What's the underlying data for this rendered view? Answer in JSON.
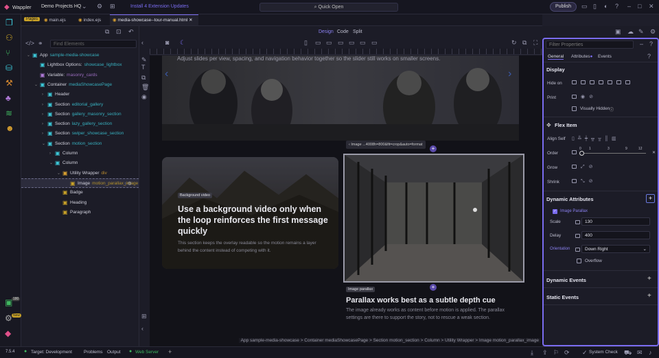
{
  "app": {
    "name": "Wappler",
    "project": "Demo Projects HQ",
    "update": "Install 4 Extension Updates",
    "quick_open": "Quick Open",
    "publish": "Publish"
  },
  "tabs": {
    "pages": "Pages",
    "items": [
      "main.ejs",
      "index.ejs",
      "media-showcase--tour-manual.html"
    ]
  },
  "tree": {
    "find_placeholder": "Find Elements",
    "items": [
      {
        "label": "App",
        "sub": "sample-media-showcase",
        "c": "cy",
        "d": 0,
        "arrow": "v"
      },
      {
        "label": "Lightbox Options:",
        "sub": "showcase_lightbox",
        "c": "cy",
        "d": 1,
        "arrow": ""
      },
      {
        "label": "Variable:",
        "sub": "masonry_cards",
        "c": "vi",
        "d": 1,
        "arrow": ""
      },
      {
        "label": "Container",
        "sub": "mediaShowcasePage",
        "c": "cy",
        "d": 1,
        "arrow": "v"
      },
      {
        "label": "Header",
        "sub": "",
        "c": "cy",
        "d": 2,
        "arrow": ">"
      },
      {
        "label": "Section",
        "sub": "editorial_gallery",
        "c": "cy",
        "d": 2,
        "arrow": ">"
      },
      {
        "label": "Section",
        "sub": "gallery_masonry_section",
        "c": "cy",
        "d": 2,
        "arrow": ">"
      },
      {
        "label": "Section",
        "sub": "lazy_gallery_section",
        "c": "cy",
        "d": 2,
        "arrow": ">"
      },
      {
        "label": "Section",
        "sub": "swiper_showcase_section",
        "c": "cy",
        "d": 2,
        "arrow": ">"
      },
      {
        "label": "Section",
        "sub": "motion_section",
        "c": "cy",
        "d": 2,
        "arrow": "v"
      },
      {
        "label": "Column",
        "sub": "",
        "c": "cy",
        "d": 3,
        "arrow": ">"
      },
      {
        "label": "Column",
        "sub": "",
        "c": "cy",
        "d": 3,
        "arrow": "v"
      },
      {
        "label": "Utility Wrapper",
        "sub": "div",
        "c": "ye",
        "d": 4,
        "arrow": "v"
      },
      {
        "label": "Image",
        "sub": "motion_parallax_image",
        "c": "gr",
        "d": 5,
        "arrow": "",
        "sel": true
      },
      {
        "label": "Badge",
        "sub": "",
        "c": "gr",
        "d": 4,
        "arrow": ""
      },
      {
        "label": "Heading",
        "sub": "",
        "c": "gr",
        "d": 4,
        "arrow": ""
      },
      {
        "label": "Paragraph",
        "sub": "",
        "c": "gr",
        "d": 4,
        "arrow": ""
      }
    ]
  },
  "toolbar": {
    "design": "Design",
    "code": "Code",
    "split": "Split"
  },
  "canvas": {
    "hero_text": "Adjust slides per view, spacing, and navigation behavior together so the slider still works on smaller screens.",
    "card": {
      "badge": "Background video",
      "heading": "Use a background video only when the loop reinforces the first message quickly",
      "body": "This section keeps the overlay readable so the motion remains a layer behind the content instead of competing with it."
    },
    "image_label": "Image ...4008h=800&fit=crop&auto=format",
    "badge2": "Image parallax",
    "heading2": "Parallax works best as a subtle depth cue",
    "para2": "The image already works as content before motion is applied. The parallax settings are there to support the story, not to rescue a weak section.",
    "breadcrumb": "App sample-media-showcase > Container mediaShowcasePage > Section motion_section > Column > Utility Wrapper > Image motion_parallax_image"
  },
  "panel": {
    "filter_placeholder": "Filter Properties",
    "tabs": [
      "General",
      "Attributes",
      "Events"
    ],
    "display": "Display",
    "hide_on": "Hide on",
    "print": "Print",
    "visually_hidden": "Visually Hidden",
    "flex_item": "Flex Item",
    "align_self": "Align Self",
    "order": "Order",
    "order_ticks": [
      "0",
      "1",
      "3",
      "9",
      "12"
    ],
    "grow": "Grow",
    "shrink": "Shrink",
    "dynamic_attributes": "Dynamic Attributes",
    "image_parallax": "Image Parallax",
    "scale_label": "Scale",
    "scale": "130",
    "delay_label": "Delay",
    "delay": "400",
    "orientation_label": "Orientation",
    "orientation": "Down Right",
    "overflow": "Overflow",
    "dynamic_events": "Dynamic Events",
    "static_events": "Static Events"
  },
  "status": {
    "version": "7.5.4",
    "target": "Target: Development",
    "problems": "Problems",
    "output": "Output",
    "web_server": "Web Server",
    "system_check": "System Check",
    "badge_count": "180",
    "notif": "New"
  },
  "colors": {
    "accent": "#7a6cf0",
    "cyan": "#3cc8d8",
    "gold": "#c9a227"
  }
}
